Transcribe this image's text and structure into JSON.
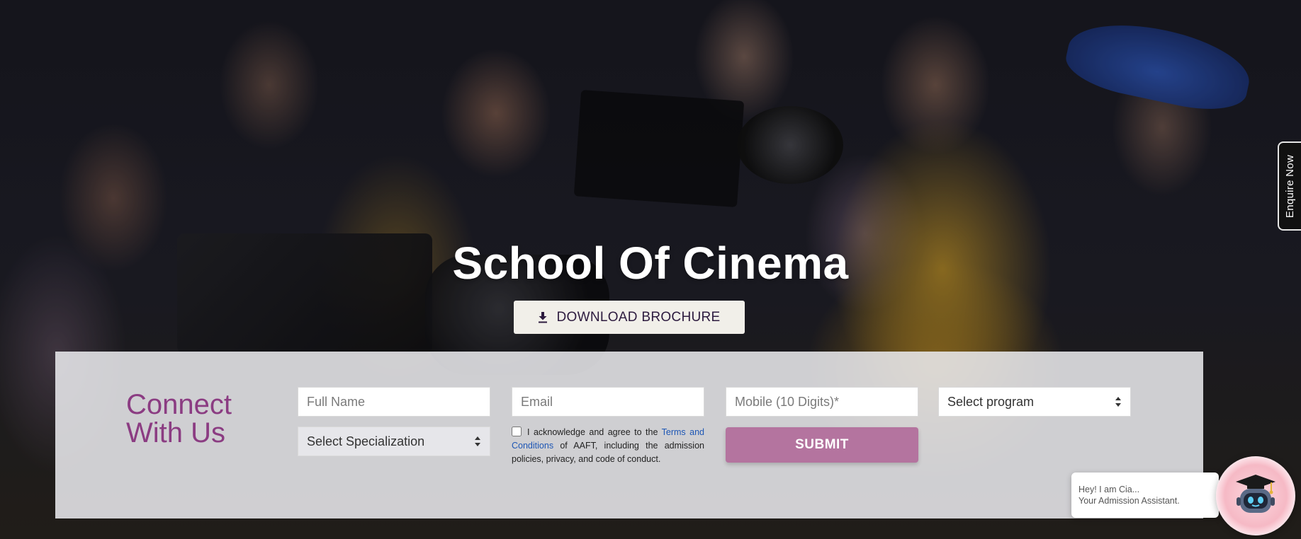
{
  "hero": {
    "title": "School Of Cinema",
    "brochure_label": "DOWNLOAD BROCHURE"
  },
  "enquire_tab": {
    "label": "Enquire Now"
  },
  "form": {
    "heading_line1": "Connect",
    "heading_line2": "With Us",
    "full_name": {
      "placeholder": "Full Name",
      "value": ""
    },
    "email": {
      "placeholder": "Email",
      "value": ""
    },
    "mobile": {
      "placeholder": "Mobile (10 Digits)*",
      "value": ""
    },
    "program_select": {
      "selected": "Select program"
    },
    "specialization_select": {
      "selected": "Select Specialization"
    },
    "acknowledgement": {
      "checked": false,
      "text_before": "I acknowledge and agree to the",
      "link_text": "Terms and Conditions",
      "text_after": "of AAFT, including the admission policies, privacy, and code of conduct."
    },
    "submit_label": "SUBMIT"
  },
  "chat": {
    "bubble_line1": "Hey! I am Cia...",
    "bubble_line2": "Your Admission Assistant.",
    "bot_icon": "robot-graduate-icon"
  },
  "colors": {
    "accent_purple": "#8b3c82",
    "submit_bg": "#b4749f",
    "link_blue": "#1e57b5"
  }
}
